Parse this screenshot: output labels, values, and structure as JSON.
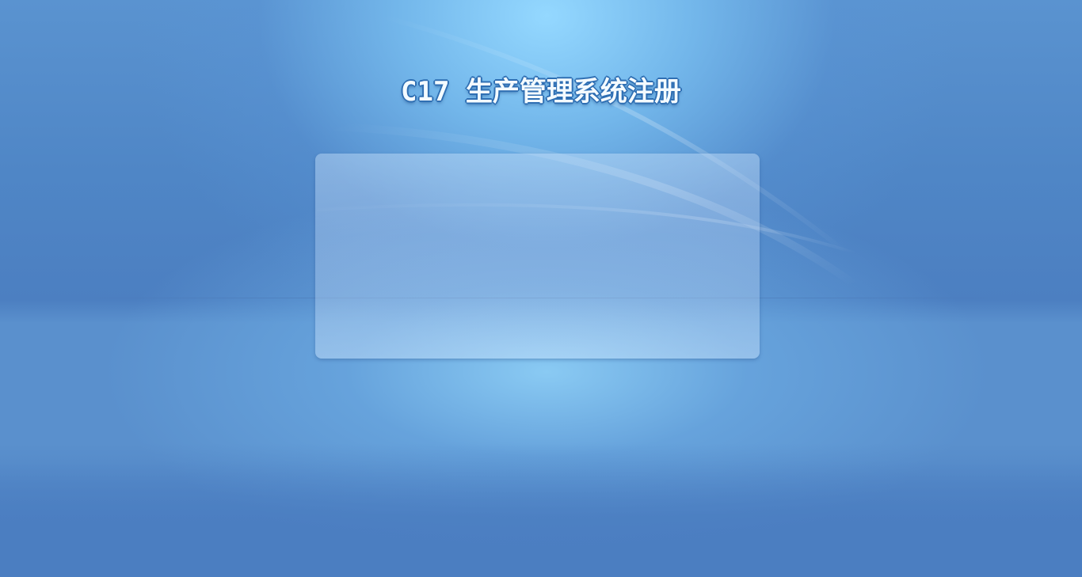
{
  "page": {
    "title": "C17 生产管理系统注册"
  },
  "colors": {
    "background": "#4d7fc2",
    "glow": "#94d8ff",
    "title_text": "#f4fbff",
    "title_outline": "#2f6fb3"
  }
}
